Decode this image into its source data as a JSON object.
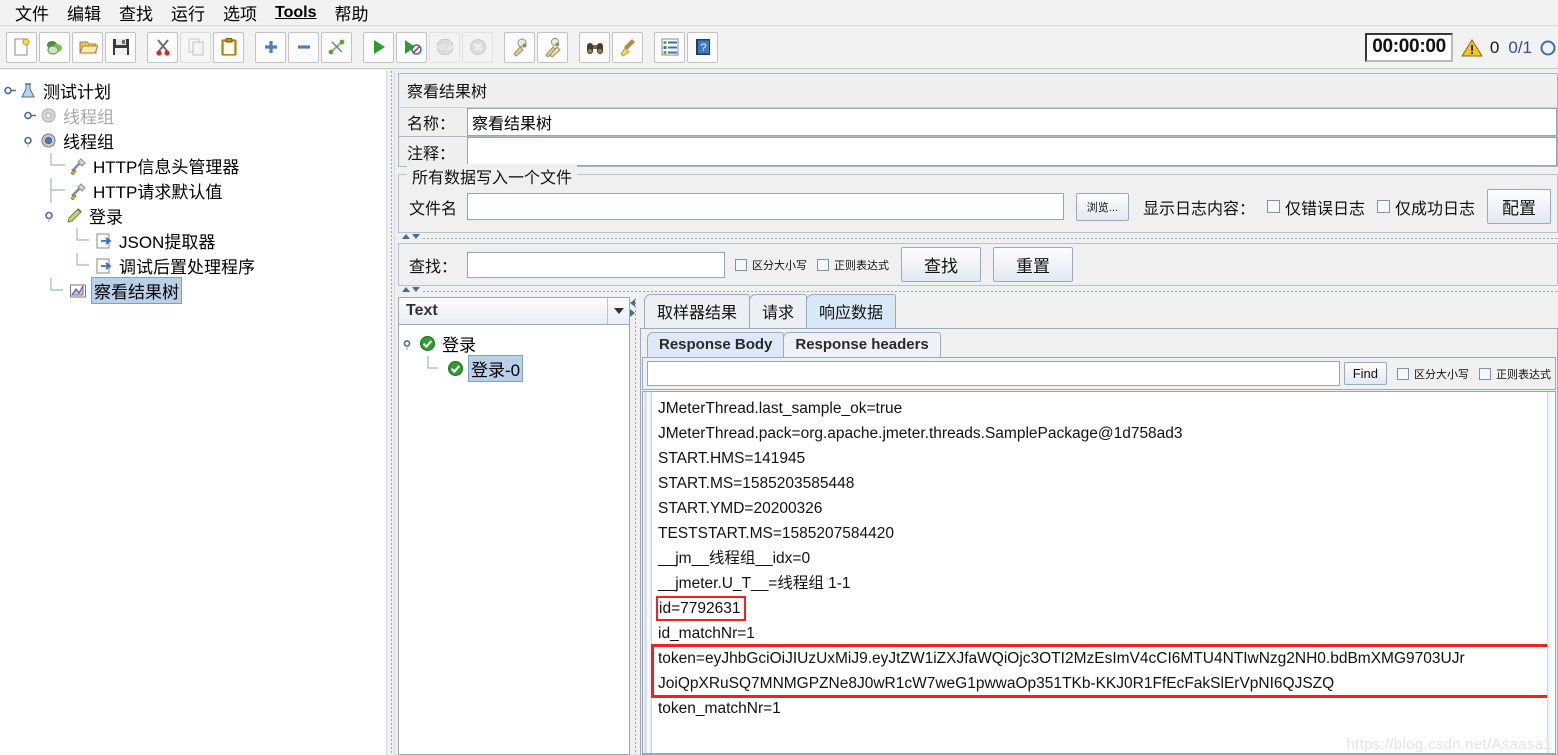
{
  "menu": {
    "items": [
      {
        "label": "文件"
      },
      {
        "label": "编辑"
      },
      {
        "label": "查找"
      },
      {
        "label": "运行"
      },
      {
        "label": "选项"
      },
      {
        "label": "Tools",
        "latin": true
      },
      {
        "label": "帮助"
      }
    ]
  },
  "toolbar": {
    "buttons": [
      {
        "name": "new-test-plan",
        "icon": "new-file-icon"
      },
      {
        "name": "templates",
        "icon": "templates-icon"
      },
      {
        "name": "open",
        "icon": "open-folder-icon"
      },
      {
        "name": "save",
        "icon": "save-disk-icon"
      },
      {
        "name": "cut",
        "icon": "scissors-icon"
      },
      {
        "name": "copy",
        "icon": "copy-icon"
      },
      {
        "name": "paste",
        "icon": "clipboard-icon"
      },
      {
        "name": "expand-all",
        "icon": "plus-icon"
      },
      {
        "name": "collapse-all",
        "icon": "minus-icon"
      },
      {
        "name": "toggle",
        "icon": "toggle-pins-icon"
      },
      {
        "name": "start",
        "icon": "play-green-icon"
      },
      {
        "name": "start-no-timers",
        "icon": "play-no-pause-icon"
      },
      {
        "name": "stop",
        "icon": "stop-sign-icon"
      },
      {
        "name": "shutdown",
        "icon": "shutdown-x-icon"
      },
      {
        "name": "clear",
        "icon": "clear-broom-icon"
      },
      {
        "name": "clear-all",
        "icon": "clear-all-broom-icon"
      },
      {
        "name": "search",
        "icon": "binoculars-icon"
      },
      {
        "name": "reset-search",
        "icon": "broom-icon"
      },
      {
        "name": "function-helper",
        "icon": "list-icon"
      },
      {
        "name": "help",
        "icon": "help-book-icon"
      }
    ],
    "timer": "00:00:00",
    "warning_count": "0",
    "thread_count": "0/1"
  },
  "tree": {
    "nodes": [
      {
        "label": "测试计划",
        "icon": "flask-icon",
        "depth": 0,
        "expanded": true,
        "dim": false,
        "selected": false
      },
      {
        "label": "线程组",
        "icon": "gear-gray-icon",
        "depth": 1,
        "expanded": false,
        "dim": true,
        "selected": false
      },
      {
        "label": "线程组",
        "icon": "gear-blue-icon",
        "depth": 1,
        "expanded": true,
        "dim": false,
        "selected": false
      },
      {
        "label": "HTTP信息头管理器",
        "icon": "wrench-icon",
        "depth": 2,
        "expanded": null,
        "dim": false,
        "selected": false
      },
      {
        "label": "HTTP请求默认值",
        "icon": "wrench-icon",
        "depth": 2,
        "expanded": null,
        "dim": false,
        "selected": false
      },
      {
        "label": "登录",
        "icon": "pen-icon",
        "depth": 2,
        "expanded": true,
        "dim": false,
        "selected": false
      },
      {
        "label": "JSON提取器",
        "icon": "arrow-page-icon",
        "depth": 3,
        "expanded": null,
        "dim": false,
        "selected": false
      },
      {
        "label": "调试后置处理程序",
        "icon": "arrow-page-icon",
        "depth": 3,
        "expanded": null,
        "dim": false,
        "selected": false
      },
      {
        "label": "察看结果树",
        "icon": "chart-icon",
        "depth": 2,
        "expanded": null,
        "dim": false,
        "selected": true
      }
    ]
  },
  "editor": {
    "panel_title": "察看结果树",
    "name_label": "名称：",
    "name_value": "察看结果树",
    "comment_label": "注释：",
    "comment_value": "",
    "filegroup": {
      "title": "所有数据写入一个文件",
      "filename_label": "文件名",
      "filename_value": "",
      "browse_button": "浏览...",
      "display_log_label": "显示日志内容：",
      "errors_only": "仅错误日志",
      "successes_only": "仅成功日志",
      "configure_button": "配置"
    },
    "search": {
      "label": "查找：",
      "value": "",
      "case_sensitive": "区分大小写",
      "regex": "正则表达式",
      "find_button": "查找",
      "reset_button": "重置"
    }
  },
  "results": {
    "render_selector": "Text",
    "tree": [
      {
        "label": "登录",
        "depth": 0,
        "selected": false,
        "expanded": true
      },
      {
        "label": "登录-0",
        "depth": 1,
        "selected": true,
        "expanded": null
      }
    ],
    "tabs": [
      {
        "label": "取样器结果",
        "active": false
      },
      {
        "label": "请求",
        "active": false
      },
      {
        "label": "响应数据",
        "active": true
      }
    ],
    "subtabs": [
      {
        "label": "Response Body",
        "active": true
      },
      {
        "label": "Response headers",
        "active": false
      }
    ],
    "findbar": {
      "value": "",
      "find_button": "Find",
      "case_sensitive": "区分大小写",
      "regex": "正则表达式"
    },
    "body_lines": [
      {
        "text": "JMeterThread.last_sample_ok=true",
        "highlight": "none"
      },
      {
        "text": "JMeterThread.pack=org.apache.jmeter.threads.SamplePackage@1d758ad3",
        "highlight": "none"
      },
      {
        "text": "START.HMS=141945",
        "highlight": "none"
      },
      {
        "text": "START.MS=1585203585448",
        "highlight": "none"
      },
      {
        "text": "START.YMD=20200326",
        "highlight": "none"
      },
      {
        "text": "TESTSTART.MS=1585207584420",
        "highlight": "none"
      },
      {
        "text": "__jm__线程组__idx=0",
        "highlight": "none"
      },
      {
        "text": "__jmeter.U_T__=线程组 1-1",
        "highlight": "none"
      },
      {
        "text": "id=7792631",
        "highlight": "box"
      },
      {
        "text": "id_matchNr=1",
        "highlight": "none"
      },
      {
        "text": "token=eyJhbGciOiJIUzUxMiJ9.eyJtZW1iZXJfaWQiOjc3OTI2MzEsImV4cCI6MTU4NTIwNzg2NH0.bdBmXMG9703UJr",
        "highlight": "wide-top"
      },
      {
        "text": "JoiQpXRuSQ7MNMGPZNe8J0wR1cW7weG1pwwaOp351TKb-KKJ0R1FfEcFakSlErVpNI6QJSZQ",
        "highlight": "wide-bottom"
      },
      {
        "text": "token_matchNr=1",
        "highlight": "none"
      }
    ]
  },
  "watermark": "https://blog.csdn.net/Asaasa1",
  "colors": {
    "accent": "#b8d0e8",
    "highlight_red": "#f41f1f",
    "tab_active": "#d9e8f7",
    "panel_bg": "#f0f0f0"
  }
}
